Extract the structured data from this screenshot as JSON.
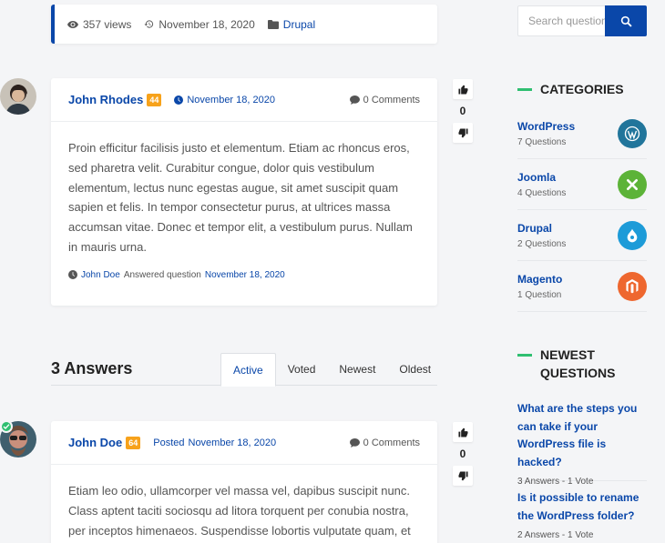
{
  "question_meta": {
    "views": "357 views",
    "date": "November 18, 2020",
    "category": "Drupal"
  },
  "question": {
    "author": "John Rhodes",
    "badge": "44",
    "date": "November 18, 2020",
    "comments": "0 Comments",
    "body": "Proin efficitur facilisis justo et elementum. Etiam ac rhoncus eros, sed pharetra velit. Curabitur congue, dolor quis vestibulum elementum, lectus nunc egestas augue, sit amet suscipit quam sapien et felis. In tempor consectetur purus, at ultrices massa accumsan vitae. Donec et tempor elit, a vestibulum purus. Nullam in mauris urna.",
    "answered_user": "John Doe",
    "answered_text": "Answered question",
    "answered_date": "November 18, 2020",
    "votes": "0"
  },
  "answers_section": {
    "title": "3 Answers",
    "tabs": [
      "Active",
      "Voted",
      "Newest",
      "Oldest"
    ]
  },
  "answer1": {
    "author": "John Doe",
    "badge": "64",
    "posted_label": "Posted",
    "date": "November 18, 2020",
    "comments": "0 Comments",
    "body": "Etiam leo odio, ullamcorper vel massa vel, dapibus suscipit nunc. Class aptent taciti sociosqu ad litora torquent per conubia nostra, per inceptos himenaeos. Suspendisse lobortis vulputate quam, et",
    "votes": "0"
  },
  "search": {
    "placeholder": "Search questions"
  },
  "categories": {
    "title": "CATEGORIES",
    "items": [
      {
        "name": "WordPress",
        "count": "7 Questions",
        "color": "#21759b",
        "icon": "wordpress-icon"
      },
      {
        "name": "Joomla",
        "count": "4 Questions",
        "color": "#5cb338",
        "icon": "joomla-icon"
      },
      {
        "name": "Drupal",
        "count": "2 Questions",
        "color": "#1d9bd8",
        "icon": "drupal-icon"
      },
      {
        "name": "Magento",
        "count": "1 Question",
        "color": "#ee672f",
        "icon": "magento-icon"
      }
    ]
  },
  "newest": {
    "title": "NEWEST QUESTIONS",
    "items": [
      {
        "title": "What are the steps you can take if your WordPress file is hacked?",
        "meta": "3 Answers - 1 Vote"
      },
      {
        "title": "Is it possible to rename the WordPress folder?",
        "meta": "2 Answers - 1 Vote"
      }
    ]
  },
  "colors": {
    "primary": "#0a47a9",
    "badge": "#f7a21b",
    "accent_green": "#2fbf71"
  }
}
